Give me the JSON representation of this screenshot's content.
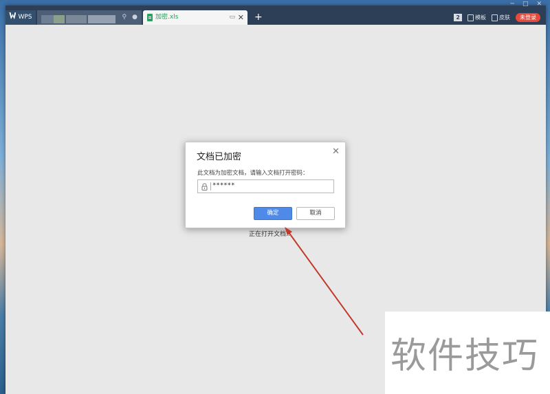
{
  "titlebar": {
    "home_tab": "WPS",
    "active_tab": {
      "label": "加密.xls"
    },
    "add_tab": "+",
    "right": {
      "counter": "2",
      "templates": "模板",
      "skin": "皮肤",
      "login": "未登录"
    }
  },
  "loading_text": "正在打开文档...",
  "dialog": {
    "title": "文档已加密",
    "prompt": "此文档为加密文档，请输入文档打开密码：",
    "password_value": "******",
    "ok": "确定",
    "cancel": "取消"
  },
  "watermark": "软件技巧",
  "colors": {
    "titlebar": "#2c3f57",
    "ok_button": "#4f8ae8",
    "annotation_arrow": "#c0392b",
    "login_badge": "#e64a3b"
  }
}
